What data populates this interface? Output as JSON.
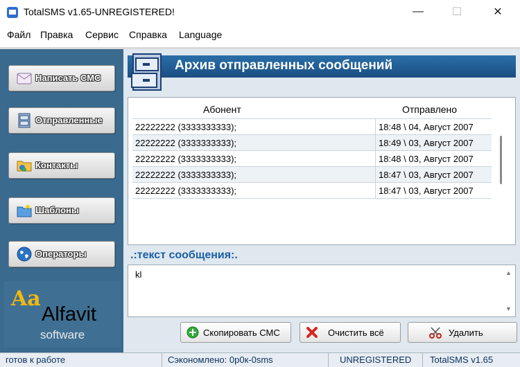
{
  "window": {
    "title": "TotalSMS v1.65-UNREGISTERED!",
    "minimize_glyph": "—",
    "maximize_glyph": "☐",
    "close_glyph": "✕"
  },
  "menu": [
    "Файл",
    "Правка",
    "Сервис",
    "Справка",
    "Language"
  ],
  "sidebar": {
    "buttons": [
      {
        "label": "Написать СМС",
        "icon": "envelope-icon"
      },
      {
        "label": "Отправленные",
        "icon": "cabinet-icon"
      },
      {
        "label": "Контакты",
        "icon": "contacts-folder-icon"
      },
      {
        "label": "Шаблоны",
        "icon": "templates-folder-icon"
      },
      {
        "label": "Операторы",
        "icon": "globe-icon"
      }
    ],
    "logo": {
      "aa": "Aa",
      "name": "Alfavit",
      "sub": "software"
    }
  },
  "main": {
    "header_title": "Архив отправленных сообщений",
    "columns": {
      "recipient": "Абонент",
      "sent": "Отправлено"
    },
    "rows": [
      {
        "recipient": "22222222 (3333333333);",
        "sent": "18:48 \\ 04, Август 2007"
      },
      {
        "recipient": "22222222 (3333333333);",
        "sent": "18:49 \\ 03, Август 2007"
      },
      {
        "recipient": "22222222 (3333333333);",
        "sent": "18:48 \\ 03, Август 2007"
      },
      {
        "recipient": "22222222 (3333333333);",
        "sent": "18:47 \\ 03, Август 2007"
      },
      {
        "recipient": "22222222 (3333333333);",
        "sent": "18:47 \\ 03, Август 2007"
      }
    ],
    "message_label": ".:текст сообщения:.",
    "message_text": "kl",
    "actions": {
      "copy": "Скопировать СМС",
      "clear": "Очистить всё",
      "delete": "Удалить"
    }
  },
  "status": {
    "state": "готов к работе",
    "saved": "Сэкономлено: 0р0к-0sms",
    "license": "UNREGISTERED",
    "version": "TotalSMS v1.65"
  },
  "colors": {
    "sidebar": "#3a6a8e",
    "header": "#1a5ea6",
    "accent_label": "#1a5ea6"
  }
}
